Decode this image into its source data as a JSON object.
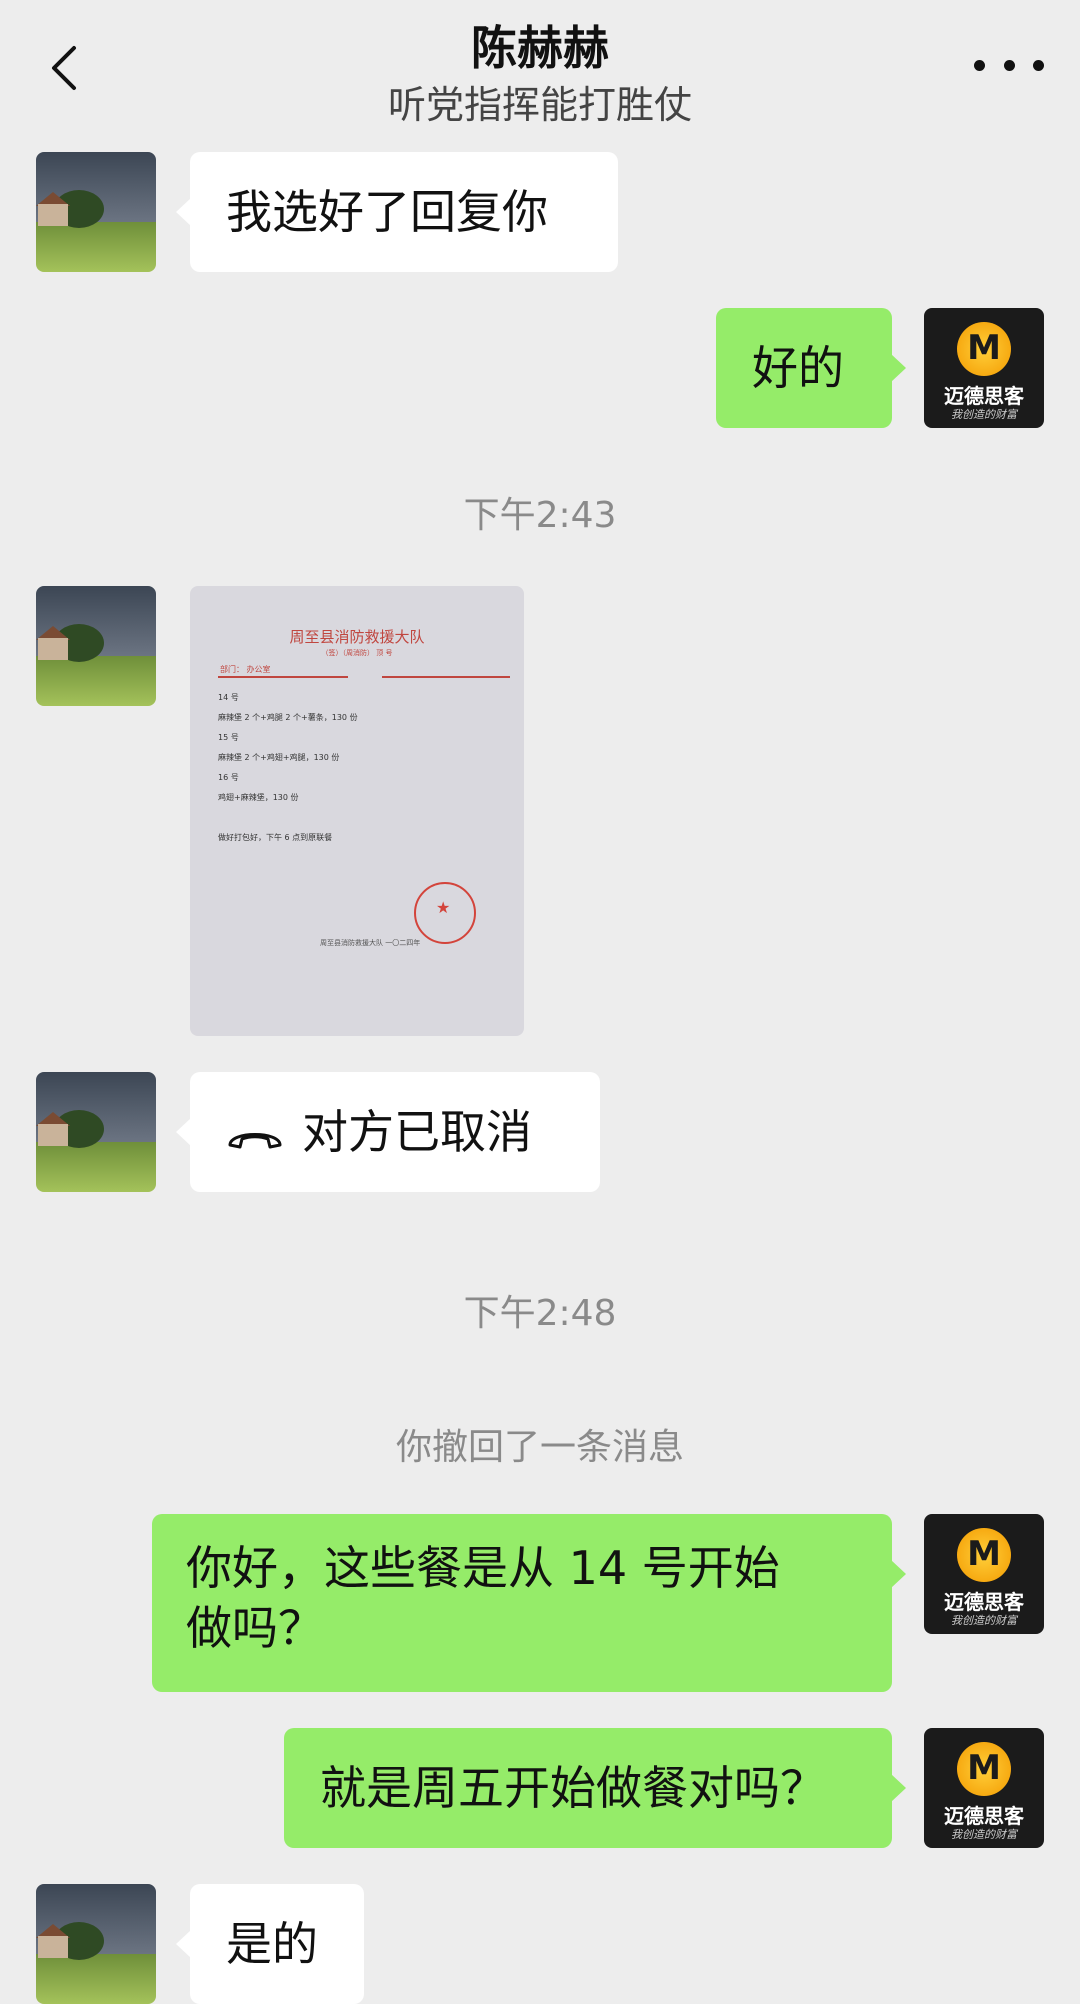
{
  "header": {
    "title": "陈赫赫",
    "subtitle": "听党指挥能打胜仗"
  },
  "brand": {
    "name": "迈德思客",
    "slogan": "我创造的财富"
  },
  "messages": {
    "m1": "我选好了回复你",
    "m2": "好的",
    "time1": "下午2:43",
    "call": "对方已取消",
    "time2": "下午2:48",
    "recall": "你撤回了一条消息",
    "m3_line1": "你好，这些餐是从 14 号开始",
    "m3_line2": "做吗？",
    "m4": "就是周五开始做餐对吗？",
    "m5": "是的"
  },
  "document": {
    "heading": "周至县消防救援大队",
    "subheading": "（签）（周消防）  顶 号",
    "from": "部门：  办公室",
    "body": "14 号\n麻辣堡 2 个+鸡腿 2 个+薯条，130 份\n15 号\n麻辣堡 2 个+鸡翅+鸡腿，130 份\n16 号\n鸡翅+麻辣堡，130 份\n\n做好打包好，下午 6 点到原联餐",
    "footer": "周至县消防救援大队  一〇二四年"
  }
}
